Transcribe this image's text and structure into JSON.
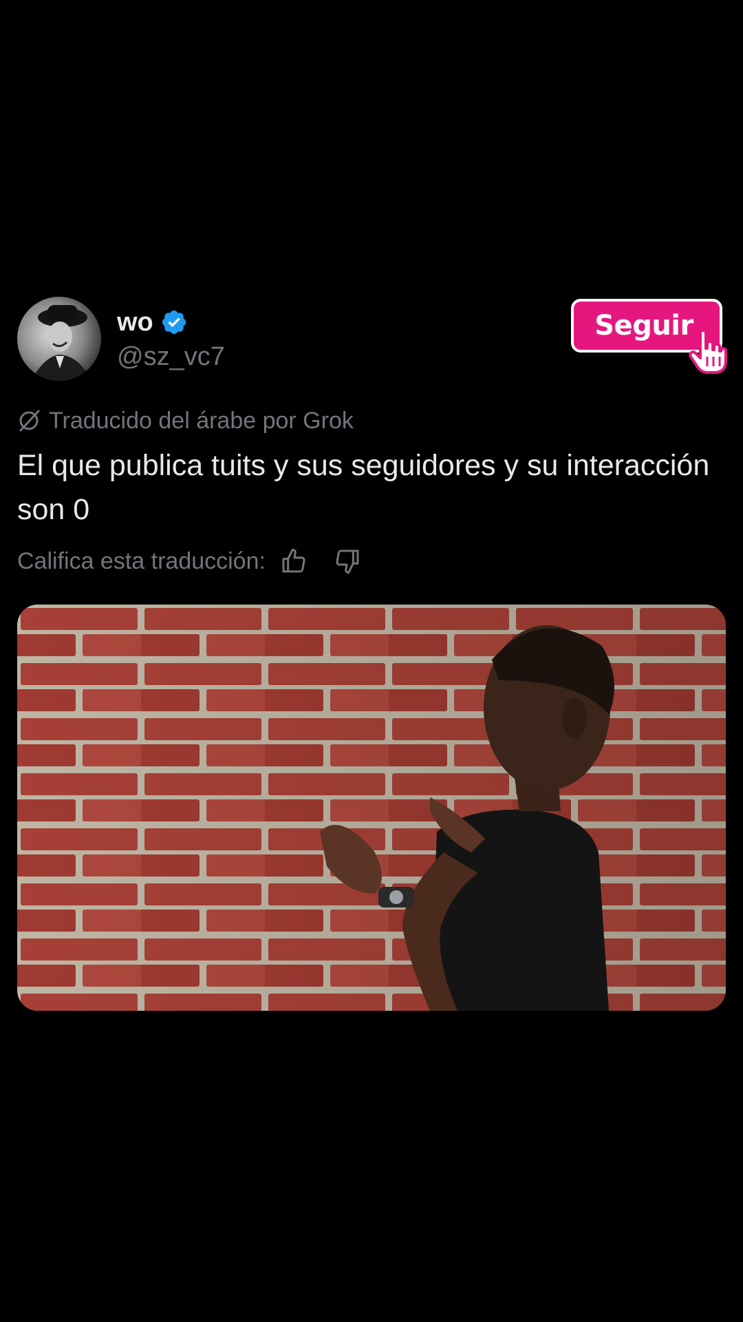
{
  "author": {
    "display_name": "wo",
    "handle": "@sz_vc7",
    "verified": true,
    "avatar_icon": "user-avatar-photo"
  },
  "follow": {
    "label": "Seguir",
    "color": "#e5177f",
    "cursor_icon": "hand-pointer-icon"
  },
  "translation": {
    "icon": "translate-icon",
    "label": "Traducido del árabe por Grok"
  },
  "tweet": {
    "text": "El que publica tuits y sus seguidores y su interacción son 0"
  },
  "rating": {
    "label": "Califica esta traducción:",
    "up_icon": "thumbs-up-icon",
    "down_icon": "thumbs-down-icon"
  },
  "media": {
    "type": "image",
    "description_icon": "meme-photo-man-talking-to-brick-wall"
  },
  "colors": {
    "background": "#000000",
    "text_primary": "#e7e9ea",
    "text_secondary": "#71767b",
    "verified_blue": "#1d9bf0",
    "accent_pink": "#e5177f"
  }
}
